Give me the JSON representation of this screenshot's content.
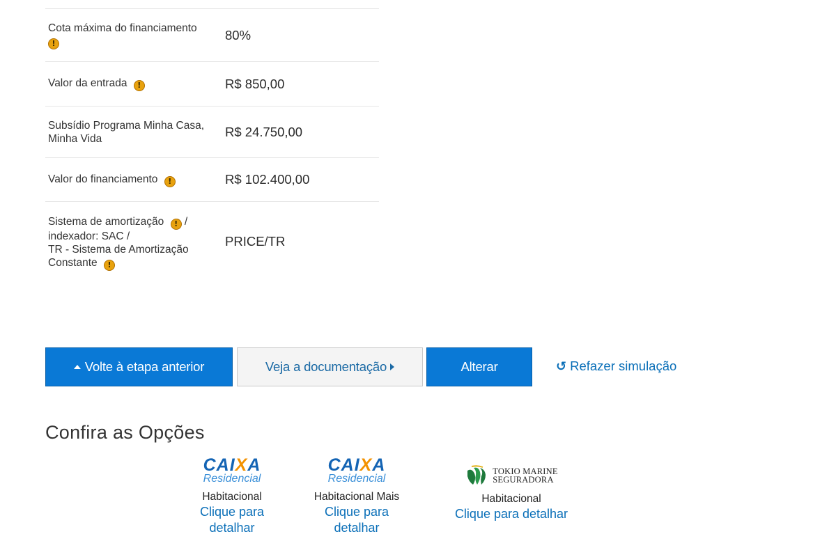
{
  "summary": {
    "rows": [
      {
        "label": "Cota máxima do financiamento",
        "value": "80%"
      },
      {
        "label": "Valor da entrada",
        "value": "R$ 850,00"
      },
      {
        "label": "Subsídio Programa Minha Casa, Minha Vida",
        "value": "R$ 24.750,00"
      },
      {
        "label": "Valor do financiamento",
        "value": "R$ 102.400,00"
      },
      {
        "label_part1": "Sistema de amortização",
        "label_part2": "/",
        "label_part3": "indexador: SAC /",
        "label_part4": "TR - Sistema de Amortização Constante",
        "value": "PRICE/TR"
      }
    ],
    "warning_icon": "warning-icon"
  },
  "buttons": {
    "back_label": "Volte à etapa anterior",
    "docs_label": "Veja a documentação",
    "alter_label": "Alterar",
    "redo_label": "Refazer simulação"
  },
  "options": {
    "title": "Confira as Opções",
    "items": [
      {
        "logo_word_1": "CAI",
        "logo_word_x": "X",
        "logo_word_2": "A",
        "logo_sub": "Residencial",
        "name": "Habitacional",
        "link": "Clique para detalhar"
      },
      {
        "logo_word_1": "CAI",
        "logo_word_x": "X",
        "logo_word_2": "A",
        "logo_sub": "Residencial",
        "name": "Habitacional Mais",
        "link": "Clique para detalhar"
      },
      {
        "logo_line_1": "TOKIO MARINE",
        "logo_line_2": "SEGURADORA",
        "name": "Habitacional",
        "link": "Clique para detalhar"
      }
    ]
  },
  "colors": {
    "primary_button": "#0a79d6",
    "link": "#0a6fb8",
    "warning": "#e8a20e",
    "caixa_blue": "#1464b4",
    "caixa_orange": "#f39200"
  }
}
